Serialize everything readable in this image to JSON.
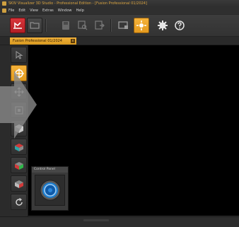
{
  "window": {
    "title": "SKIV Visualizer 3D Studio - Professional Edition - [Fusion Professional 01/2024]"
  },
  "menu": {
    "items": [
      "File",
      "Edit",
      "View",
      "Extras",
      "Window",
      "Help"
    ]
  },
  "toolbar": {
    "buttons": [
      {
        "icon": "new-project-icon"
      },
      {
        "icon": "open-folder-icon"
      },
      {
        "icon": "save-disk-icon"
      },
      {
        "icon": "search-magnify-icon"
      },
      {
        "icon": "export-icon"
      },
      {
        "icon": "screen-capture-icon"
      },
      {
        "icon": "target-view-icon"
      },
      {
        "icon": "gear-icon"
      },
      {
        "icon": "help-icon"
      }
    ]
  },
  "tabs": {
    "active_label": "Fusion Professional 01/2024",
    "close_glyph": "x"
  },
  "control_panel": {
    "title": "Control Panel"
  },
  "colors": {
    "accent": "#f0aa30",
    "brand_red": "#c8282e",
    "viewport_bg": "#000000"
  }
}
